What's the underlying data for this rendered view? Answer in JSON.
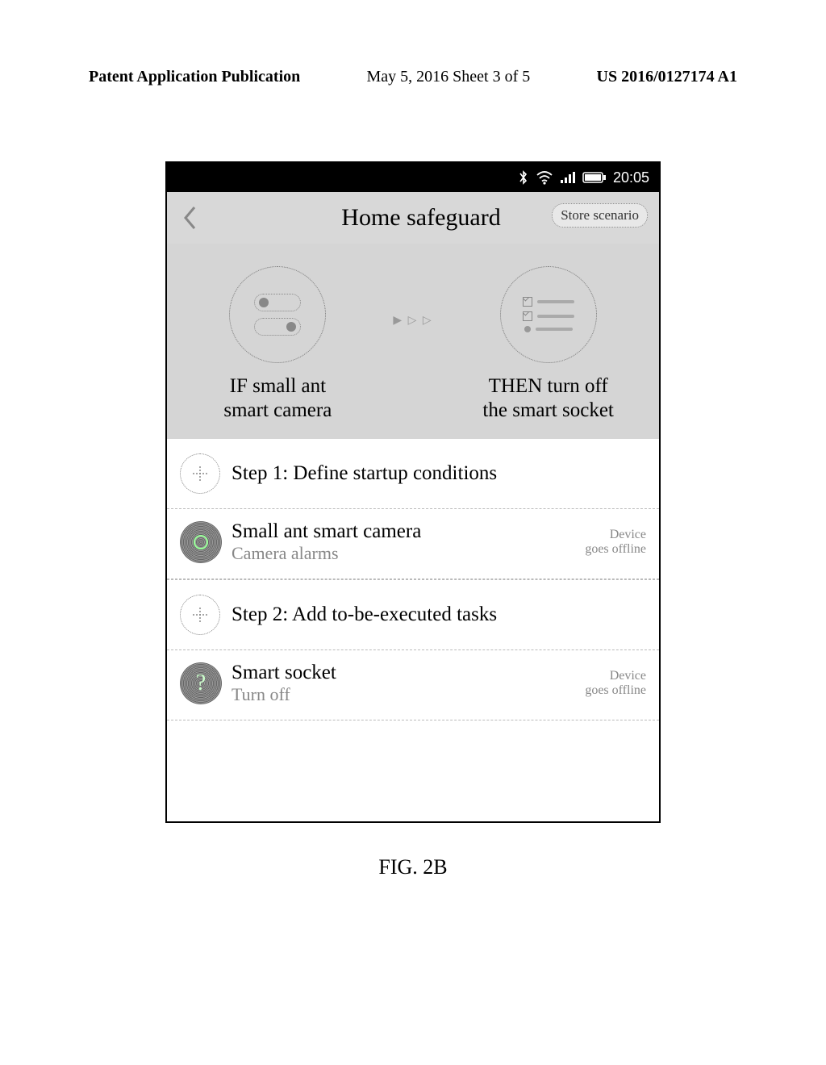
{
  "page_header": {
    "left": "Patent Application Publication",
    "center": "May 5, 2016  Sheet 3 of 5",
    "right": "US 2016/0127174 A1"
  },
  "status_bar": {
    "time": "20:05"
  },
  "title_bar": {
    "title": "Home safeguard",
    "store_button": "Store scenario"
  },
  "scenario": {
    "if_label": "IF small ant\nsmart camera",
    "then_label": "THEN turn off\nthe smart socket"
  },
  "step1": {
    "title": "Step 1: Define startup conditions",
    "device_title": "Small ant smart camera",
    "device_sub": "Camera alarms",
    "device_status": "Device\ngoes offline"
  },
  "step2": {
    "title": "Step 2: Add to-be-executed tasks",
    "device_title": "Smart socket",
    "device_sub": "Turn off",
    "device_status": "Device\ngoes offline"
  },
  "caption": "FIG. 2B"
}
